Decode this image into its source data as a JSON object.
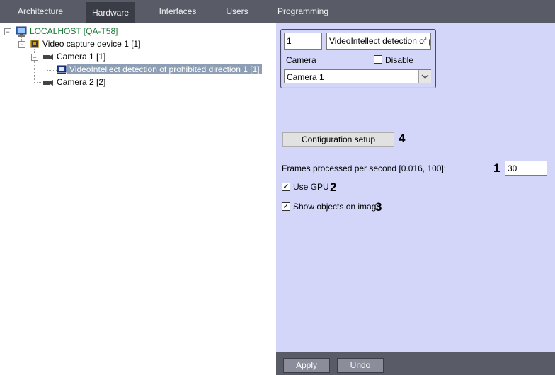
{
  "tabs": [
    {
      "label": "Architecture",
      "active": false
    },
    {
      "label": "Hardware",
      "active": true
    },
    {
      "label": "Interfaces",
      "active": false
    },
    {
      "label": "Users",
      "active": false
    },
    {
      "label": "Programming",
      "active": false
    }
  ],
  "tree": {
    "server": "LOCALHOST [QA-T58]",
    "device": "Video capture device 1 [1]",
    "camera1": "Camera 1 [1]",
    "detector": "VideoIntellect detection of prohibited direction 1 [1]",
    "camera2": "Camera 2 [2]"
  },
  "header": {
    "id_value": "1",
    "name_value": "VideoIntellect detection of pro",
    "camera_label": "Camera",
    "disable_label": "Disable",
    "disable_checked": false,
    "camera_select": "Camera 1"
  },
  "settings": {
    "config_button": "Configuration setup",
    "fps_label": "Frames processed per second [0.016, 100]:",
    "fps_value": "30",
    "use_gpu_label": "Use GPU",
    "use_gpu_checked": true,
    "show_objects_label": "Show objects on image",
    "show_objects_checked": true
  },
  "annotations": {
    "fps": "1",
    "gpu": "2",
    "show": "3",
    "config": "4"
  },
  "footer": {
    "apply": "Apply",
    "undo": "Undo"
  }
}
